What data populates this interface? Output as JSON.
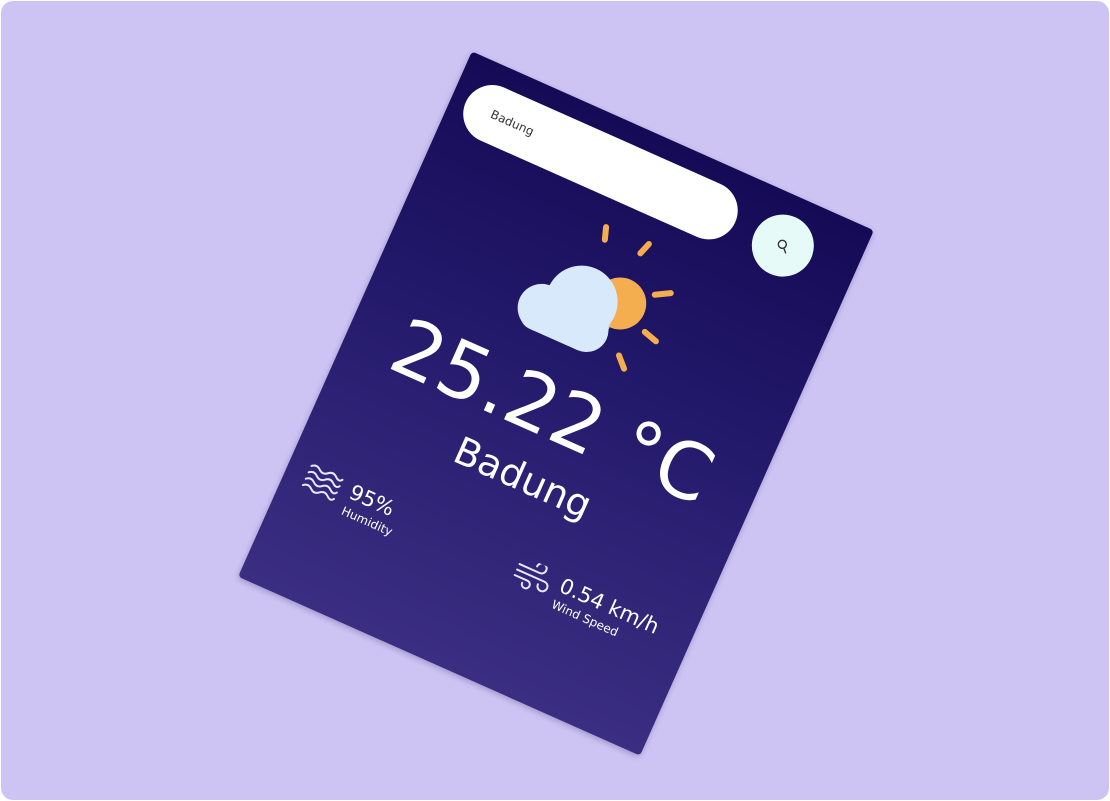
{
  "search": {
    "value": "Badung",
    "button_icon": "search-icon"
  },
  "weather": {
    "condition_icon": "partly-cloudy-icon",
    "temperature": "25.22 °C",
    "city": "Badung"
  },
  "stats": {
    "humidity": {
      "icon": "humidity-waves-icon",
      "value": "95%",
      "label": "Humidity"
    },
    "wind": {
      "icon": "wind-icon",
      "value": "0.54 km/h",
      "label": "Wind Speed"
    }
  },
  "colors": {
    "background": "#cdc4f3",
    "card_top": "#140a55",
    "card_bottom": "#3b2e82",
    "search_button": "#e6fbf8",
    "sun": "#f4ad4f",
    "cloud": "#d8e9fb"
  }
}
